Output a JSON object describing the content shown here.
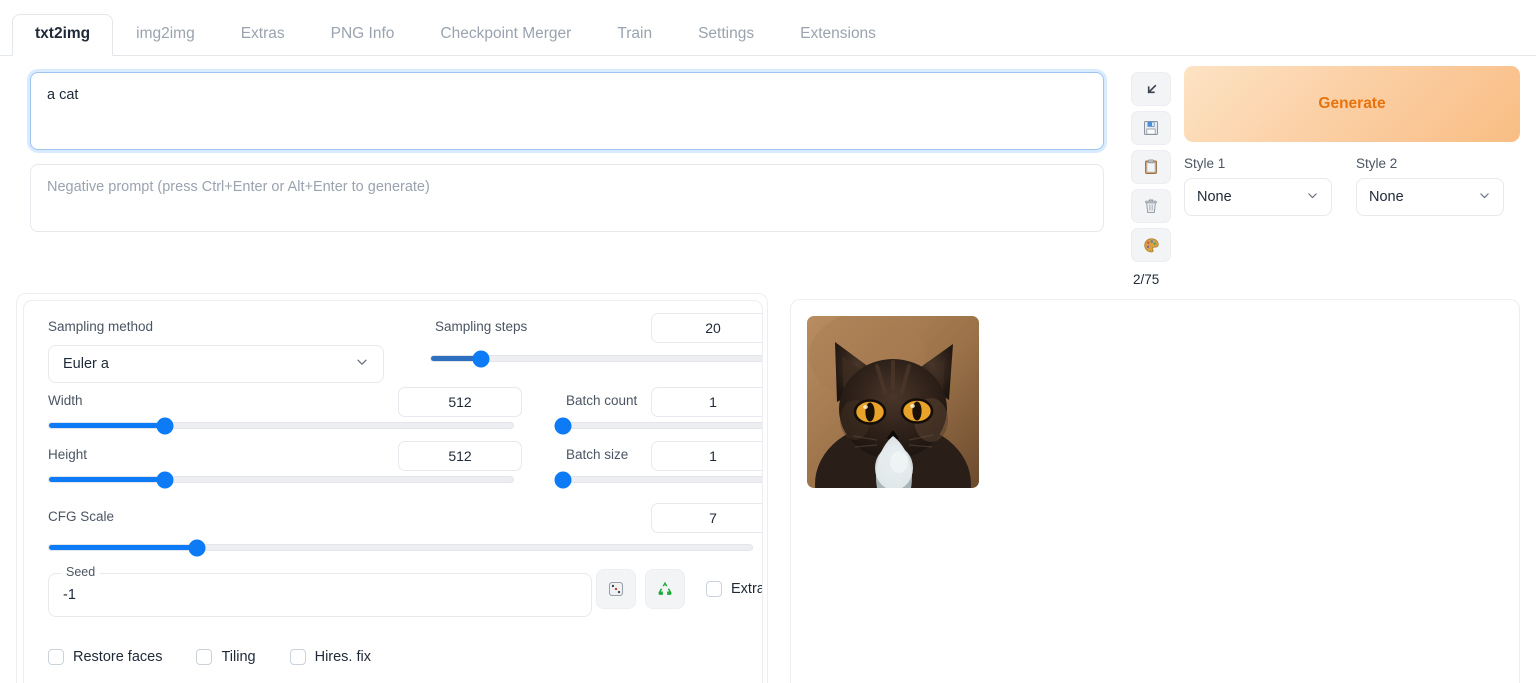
{
  "tabs": [
    {
      "label": "txt2img",
      "active": true
    },
    {
      "label": "img2img",
      "active": false
    },
    {
      "label": "Extras",
      "active": false
    },
    {
      "label": "PNG Info",
      "active": false
    },
    {
      "label": "Checkpoint Merger",
      "active": false
    },
    {
      "label": "Train",
      "active": false
    },
    {
      "label": "Settings",
      "active": false
    },
    {
      "label": "Extensions",
      "active": false
    }
  ],
  "prompt": {
    "value": "a cat",
    "negative_placeholder": "Negative prompt (press Ctrl+Enter or Alt+Enter to generate)",
    "token_count": "2/75"
  },
  "tools": [
    {
      "name": "restore-progress-icon",
      "glyph": "↙"
    },
    {
      "name": "save-style-icon",
      "glyph": "💾"
    },
    {
      "name": "paste-clipboard-icon",
      "glyph": "📋"
    },
    {
      "name": "clear-prompt-icon",
      "glyph": "🗑"
    },
    {
      "name": "apply-style-icon",
      "glyph": "🎨"
    }
  ],
  "generate": {
    "label": "Generate",
    "accent": "#e8730c"
  },
  "styles": [
    {
      "label": "Style 1",
      "value": "None"
    },
    {
      "label": "Style 2",
      "value": "None"
    }
  ],
  "settings": {
    "sampling_method": {
      "label": "Sampling method",
      "value": "Euler a"
    },
    "sampling_steps": {
      "label": "Sampling steps",
      "value": "20",
      "pct": 15
    },
    "width": {
      "label": "Width",
      "value": "512",
      "pct": 25
    },
    "height": {
      "label": "Height",
      "value": "512",
      "pct": 25
    },
    "batch_count": {
      "label": "Batch count",
      "value": "1",
      "pct": 0
    },
    "batch_size": {
      "label": "Batch size",
      "value": "1",
      "pct": 0
    },
    "cfg_scale": {
      "label": "CFG Scale",
      "value": "7",
      "pct": 21
    },
    "seed": {
      "label": "Seed",
      "value": "-1"
    },
    "seed_buttons": [
      {
        "name": "random-seed-dice-icon",
        "glyph": "🎲"
      },
      {
        "name": "reuse-seed-recycle-icon",
        "glyph": "♻"
      }
    ],
    "extra_checkbox": {
      "label": "Extra",
      "checked": false
    },
    "bottom_checkboxes": [
      {
        "label": "Restore faces",
        "checked": false
      },
      {
        "label": "Tiling",
        "checked": false
      },
      {
        "label": "Hires. fix",
        "checked": false
      }
    ]
  },
  "output": {
    "image_alt": "generated cat portrait",
    "image_colors": {
      "bg_light": "#b5875c",
      "bg_dark": "#6d4b2f",
      "fur_dark": "#241a14",
      "fur_mid": "#3d2c21",
      "eye": "#e9a32a",
      "chest": "#dfe4e6"
    }
  },
  "theme": {
    "slider_blue": "#0d7bf5",
    "slider_blue_dark": "#2f6fc0",
    "border": "#e7e9ee",
    "text": "#1f2937",
    "muted": "#9aa3af"
  }
}
